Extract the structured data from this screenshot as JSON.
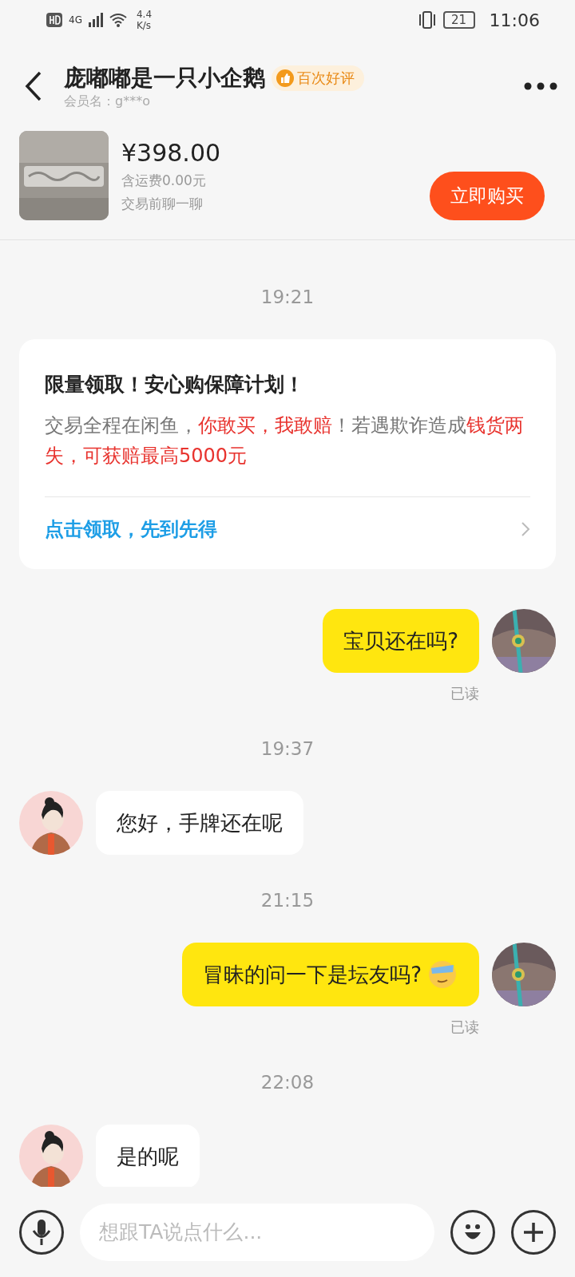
{
  "status_bar": {
    "network": "4G",
    "speed_value": "4.4",
    "speed_unit": "K/s",
    "battery": "21",
    "time": "11:06"
  },
  "header": {
    "title": "庞嘟嘟是一只小企鹅",
    "badge": "百次好评",
    "member": "会员名：g***o"
  },
  "product": {
    "price": "¥398.00",
    "shipping": "含运费0.00元",
    "note": "交易前聊一聊",
    "buy_button": "立即购买"
  },
  "messages": [
    {
      "kind": "time",
      "text": "19:21"
    },
    {
      "kind": "promo",
      "title": "限量领取！安心购保障计划！",
      "segments": [
        {
          "text": "交易全程在闲鱼，",
          "highlight": false
        },
        {
          "text": "你敢买，我敢赔",
          "highlight": true
        },
        {
          "text": "！若遇欺诈造成",
          "highlight": false
        },
        {
          "text": "钱货两失，可获赔最高5000元",
          "highlight": true
        }
      ],
      "link": "点击领取，先到先得"
    },
    {
      "kind": "outgoing",
      "text": "宝贝还在吗?",
      "emoji": false,
      "receipt": "已读"
    },
    {
      "kind": "time",
      "text": "19:37"
    },
    {
      "kind": "incoming",
      "text": "您好，手牌还在呢"
    },
    {
      "kind": "time",
      "text": "21:15"
    },
    {
      "kind": "outgoing",
      "text": "冒昧的问一下是坛友吗?",
      "emoji": true,
      "receipt": "已读"
    },
    {
      "kind": "time",
      "text": "22:08"
    },
    {
      "kind": "incoming",
      "text": "是的呢"
    }
  ],
  "input": {
    "placeholder": "想跟TA说点什么..."
  }
}
